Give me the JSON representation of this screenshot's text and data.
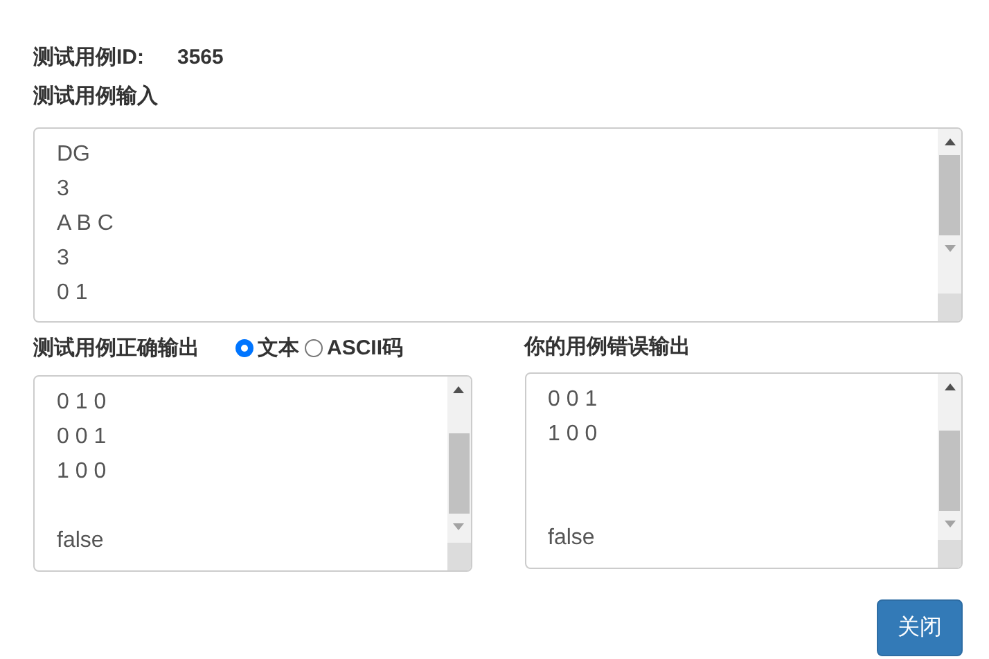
{
  "test_case_id": {
    "label": "测试用例ID:",
    "value": "3565"
  },
  "input": {
    "label": "测试用例输入",
    "text": "DG\n3\nA B C\n3\n0 1"
  },
  "expected_output": {
    "label": "测试用例正确输出",
    "text": "0 1 0\n0 0 1\n1 0 0\n\nfalse",
    "format_options": [
      {
        "label": "文本",
        "selected": true
      },
      {
        "label": "ASCII码",
        "selected": false
      }
    ]
  },
  "your_output": {
    "label": "你的用例错误输出",
    "text": "0 0 1\n1 0 0\n\n\nfalse"
  },
  "close_button": "关闭"
}
